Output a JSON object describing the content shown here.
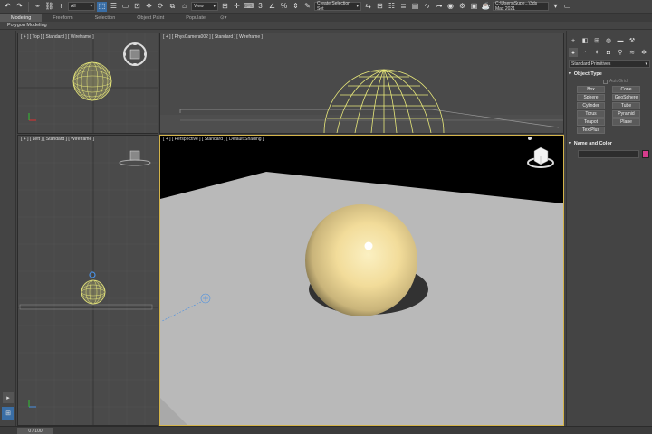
{
  "toolbar": {
    "selection_filter": "All",
    "view_dropdown": "View",
    "selection_set": "Create Selection Set",
    "project_path": "C:\\Users\\Supe...\\3ds Max 2021"
  },
  "ribbon": {
    "tabs": [
      {
        "label": "Modeling",
        "active": true
      },
      {
        "label": "Freeform",
        "active": false
      },
      {
        "label": "Selection",
        "active": false
      },
      {
        "label": "Object Paint",
        "active": false
      },
      {
        "label": "Populate",
        "active": false
      }
    ],
    "sub_label": "Polygon Modeling"
  },
  "viewports": {
    "top_label": "[ + ] [ Top ] [ Standard ] [ Wireframe ]",
    "front_label": "[ + ] [ PhysCamera002 ] [ Standard ] [ Wireframe ]",
    "left_label": "[ + ] [ Left ] [ Standard ] [ Wireframe ]",
    "persp_label": "[ + ] [ Perspective ] [ Standard ] [ Default Shading ]"
  },
  "command_panel": {
    "category_dropdown": "Standard Primitives",
    "object_type_title": "Object Type",
    "autogrid_label": "AutoGrid",
    "primitives": [
      "Box",
      "Cone",
      "Sphere",
      "GeoSphere",
      "Cylinder",
      "Tube",
      "Torus",
      "Pyramid",
      "Teapot",
      "Plane",
      "TextPlus"
    ],
    "name_color_title": "Name and Color",
    "object_color": "#d63c8c"
  },
  "timeline": {
    "frame_display": "0 / 100"
  },
  "colors": {
    "sphere_fill": "#f2dc9a",
    "wireframe": "#e8e87a",
    "active_viewport_border": "#d4b44a",
    "accent": "#3a6ea5"
  }
}
